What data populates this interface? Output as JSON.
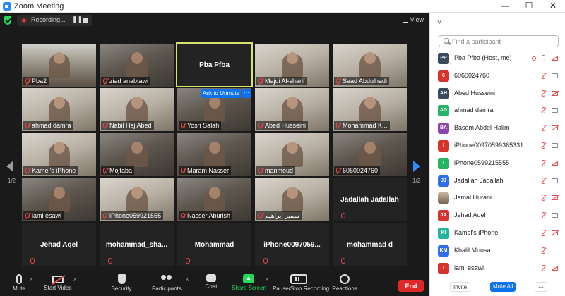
{
  "window": {
    "title": "Zoom Meeting",
    "minimize": "—",
    "maximize": "☐",
    "close": "✕"
  },
  "topbar": {
    "recording_label": "Recording...",
    "pause_glyph": "❚❚",
    "view_label": "View"
  },
  "grid": {
    "active_tile": "Pba Pfba",
    "ask_unmute": "Ask to Unmute",
    "ask_more": "···",
    "page_left": "1/2",
    "page_right": "1/2",
    "tiles": [
      {
        "name": "Pba2"
      },
      {
        "name": "ziad anabtawi"
      },
      {
        "name": "Pba Pfba"
      },
      {
        "name": "Majdi Al-sharif"
      },
      {
        "name": "Saad Abdulhadi"
      },
      {
        "name": "ahmad damra"
      },
      {
        "name": "Nabil Haj Abed"
      },
      {
        "name": "Yosri Salah"
      },
      {
        "name": "Abed Husseini"
      },
      {
        "name": "Mohammad K..."
      },
      {
        "name": "Kamel's iPhone"
      },
      {
        "name": "Mojtaba"
      },
      {
        "name": "Maram Nasser"
      },
      {
        "name": "manmoud"
      },
      {
        "name": "6060024760"
      },
      {
        "name": "lami esawi"
      },
      {
        "name": "iPhone059921555"
      },
      {
        "name": "Nasser Aburish"
      },
      {
        "name": "سمير إبراهيم"
      },
      {
        "name": "Jadallah Jadallah"
      },
      {
        "name": "Jehad Aqel"
      },
      {
        "name": "mohammad_sha..."
      },
      {
        "name": "Mohammad"
      },
      {
        "name": "iPhone0097059..."
      },
      {
        "name": "mohammad d"
      }
    ]
  },
  "toolbar": {
    "mute": "Mute",
    "start_video": "Start Video",
    "security": "Security",
    "participants": "Participants",
    "chat": "Chat",
    "share_screen": "Share Screen",
    "pause_stop_recording": "Pause/Stop Recording",
    "reactions": "Reactions",
    "end": "End",
    "caret": "˄"
  },
  "panel": {
    "collapse_glyph": "˅",
    "search_placeholder": "Find a participant",
    "invite": "Invite",
    "mute_all": "Mute All",
    "more": "···",
    "participants": [
      {
        "initials": "PP",
        "color": "#3a4a5c",
        "name": "Pba Pfba (Host, me)"
      },
      {
        "initials": "6",
        "color": "#d9342b",
        "name": "6060024760"
      },
      {
        "initials": "AH",
        "color": "#3a4a5c",
        "name": "Abed Husseini"
      },
      {
        "initials": "AD",
        "color": "#23b563",
        "name": "ahmad damra"
      },
      {
        "initials": "BA",
        "color": "#8e44ad",
        "name": "Basem Abdel Halim"
      },
      {
        "initials": "I",
        "color": "#d9342b",
        "name": "iPhone00970599365331"
      },
      {
        "initials": "I",
        "color": "#23b563",
        "name": "iPhone0599215555"
      },
      {
        "initials": "JJ",
        "color": "#2d6ff0",
        "name": "Jadallah Jadallah"
      },
      {
        "initials": "",
        "color": "#a58a70",
        "name": "Jamal Hurani"
      },
      {
        "initials": "JA",
        "color": "#d9342b",
        "name": "Jehad Aqel"
      },
      {
        "initials": "KI",
        "color": "#23b5a0",
        "name": "Kamel's iPhone"
      },
      {
        "initials": "KM",
        "color": "#2d6ff0",
        "name": "Khalil Mousa"
      },
      {
        "initials": "I",
        "color": "#d9342b",
        "name": "lami esawi"
      }
    ]
  }
}
